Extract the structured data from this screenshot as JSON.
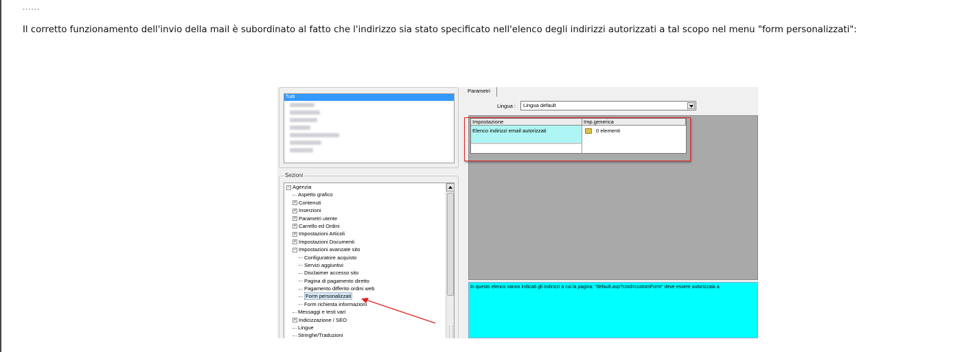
{
  "doc": {
    "ellipsis": "......",
    "intro": "Il corretto funzionamento dell'invio della mail è subordinato al fatto che l'indirizzo sia stato specificato nell'elenco degli indirizzi autorizzati a tal scopo nel menu \"form personalizzati\":"
  },
  "screenshot": {
    "area_list": {
      "selected_item": "Tutti"
    },
    "sezioni": {
      "legend": "Sezioni",
      "tree": [
        {
          "label": "Agenzia",
          "type": "expanded"
        },
        {
          "label": "Aspetto grafico",
          "type": "leaf"
        },
        {
          "label": "Contenuti",
          "type": "collapsed"
        },
        {
          "label": "Inserzioni",
          "type": "collapsed"
        },
        {
          "label": "Parametri utente",
          "type": "collapsed"
        },
        {
          "label": "Carrello ed Ordini",
          "type": "collapsed"
        },
        {
          "label": "Impostazioni Articoli",
          "type": "collapsed"
        },
        {
          "label": "Impostazioni Documenti",
          "type": "collapsed"
        },
        {
          "label": "Impostazioni avanzate sito",
          "type": "expanded"
        },
        {
          "label": "Configuratore acquisto",
          "type": "leaf"
        },
        {
          "label": "Servizi aggiuntivi",
          "type": "leaf"
        },
        {
          "label": "Disclaimer accesso sito",
          "type": "leaf"
        },
        {
          "label": "Pagina di pagamento diretto",
          "type": "leaf"
        },
        {
          "label": "Pagamento differito ordini web",
          "type": "leaf"
        },
        {
          "label": "Form personalizzati",
          "type": "leaf"
        },
        {
          "label": "Form richiesta informazioni",
          "type": "leaf"
        },
        {
          "label": "Messaggi e testi vari",
          "type": "leaf"
        },
        {
          "label": "Indicizzazione / SEO",
          "type": "collapsed"
        },
        {
          "label": "Lingue",
          "type": "leaf"
        },
        {
          "label": "Stringhe/Traduzioni",
          "type": "leaf"
        }
      ],
      "selected": "Form personalizzati"
    },
    "right": {
      "tab": "Parametri",
      "lingua_label": "Lingua :",
      "lingua_value": "Lingua default",
      "grid": {
        "headers": [
          "Impostazione",
          "Imp.generica"
        ],
        "row_setting": "Elenco indirizzi email autorizzati",
        "row_value": "0 elementi"
      },
      "description": "In questo elenco vanno indicati gli indirizzi a cui la pagina: \"default.asp?cmd=customForm\" deve essere autorizzata a"
    },
    "colors": {
      "highlight": "#e02020",
      "description_bg": "#00ffff",
      "selected_row": "#3399ff"
    }
  }
}
